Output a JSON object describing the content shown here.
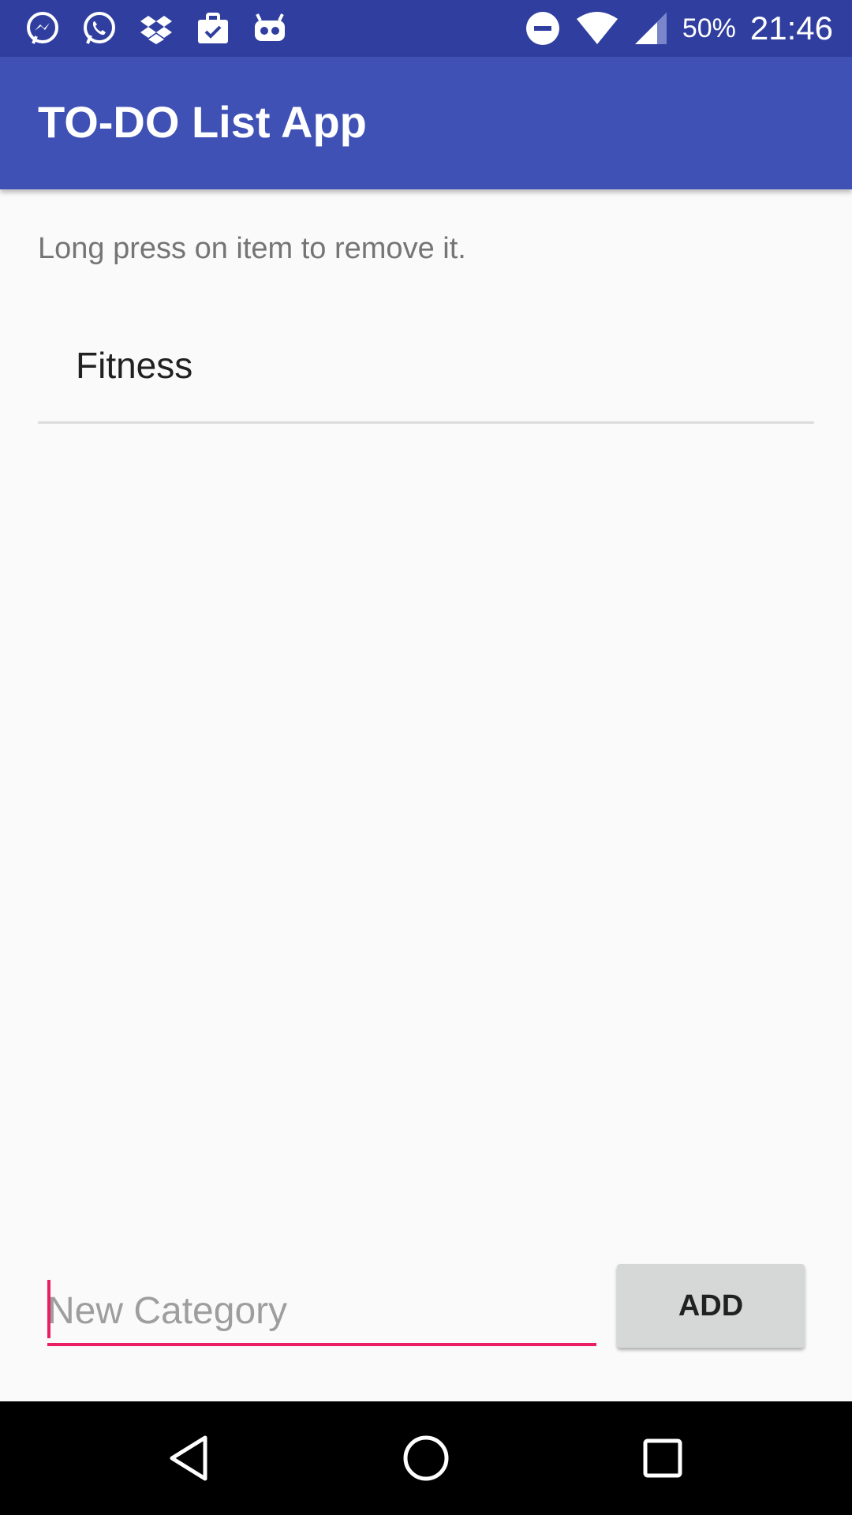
{
  "status_bar": {
    "left_icons": [
      "messenger-icon",
      "whatsapp-icon",
      "dropbox-icon",
      "briefcase-check-icon",
      "android-robot-icon"
    ],
    "right_icons": [
      "do-not-disturb-icon",
      "wifi-icon",
      "signal-icon"
    ],
    "battery": "50%",
    "time": "21:46"
  },
  "app_bar": {
    "title": "TO-DO List App"
  },
  "hint": "Long press on item to remove it.",
  "categories": [
    {
      "label": "Fitness"
    }
  ],
  "input": {
    "placeholder": "New Category",
    "value": ""
  },
  "add_button": {
    "label": "ADD"
  },
  "nav_bar": {
    "icons": [
      "back-icon",
      "home-icon",
      "recents-icon"
    ]
  },
  "colors": {
    "status_bar": "#303f9f",
    "app_bar": "#3f51b5",
    "accent": "#e91e63",
    "background": "#fafafa"
  }
}
